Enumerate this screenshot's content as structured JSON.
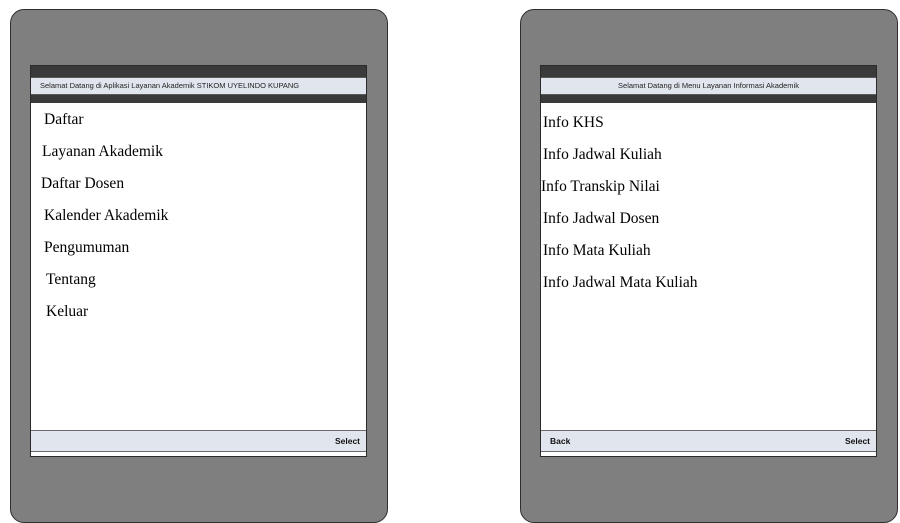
{
  "left_screen": {
    "title": "Selamat Datang di Aplikasi Layanan Akademik STIKOM UYELINDO KUPANG",
    "menu": [
      "Daftar",
      "Layanan Akademik",
      "Daftar Dosen",
      "Kalender Akademik",
      "Pengumuman",
      "Tentang",
      "Keluar"
    ],
    "softkeys": {
      "right": "Select"
    }
  },
  "right_screen": {
    "title": "Selamat Datang di Menu Layanan Informasi Akademik",
    "menu": [
      "Info KHS",
      "Info Jadwal Kuliah",
      "Info Transkip Nilai",
      "Info Jadwal Dosen",
      "Info Mata Kuliah",
      "Info Jadwal Mata Kuliah"
    ],
    "softkeys": {
      "left": "Back",
      "right": "Select"
    }
  }
}
